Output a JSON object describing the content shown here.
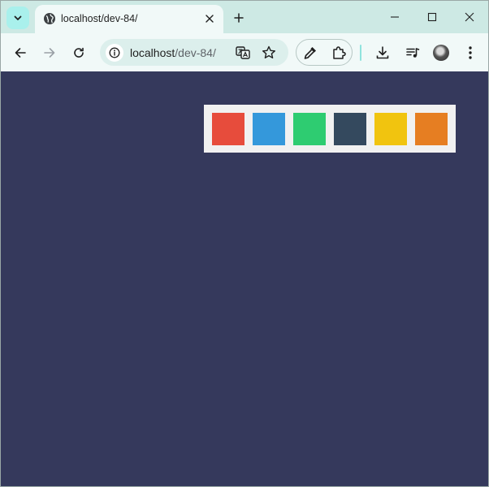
{
  "browser": {
    "tab": {
      "title": "localhost/dev-84/"
    },
    "omnibox": {
      "host": "localhost",
      "path": "/dev-84/"
    }
  },
  "icons": {
    "tab_search": "chevron-down-icon",
    "favicon": "globe-icon",
    "tab_close": "close-icon",
    "new_tab": "plus-icon",
    "minimize": "minimize-icon",
    "maximize": "maximize-icon",
    "close_window": "close-icon",
    "back": "arrow-left-icon",
    "forward": "arrow-right-icon",
    "reload": "reload-icon",
    "site_info": "info-icon",
    "translate": "translate-icon",
    "bookmark": "star-icon",
    "eyedropper": "eyedropper-icon",
    "extensions": "puzzle-icon",
    "download": "download-icon",
    "media": "media-queue-icon",
    "menu": "kebab-menu-icon"
  },
  "colors": {
    "page_background": "#35395c",
    "panel_background": "#f1f1f1",
    "swatches": [
      "#e74c3c",
      "#3498db",
      "#2ecc71",
      "#34495e",
      "#f1c40f",
      "#e67e22"
    ]
  }
}
